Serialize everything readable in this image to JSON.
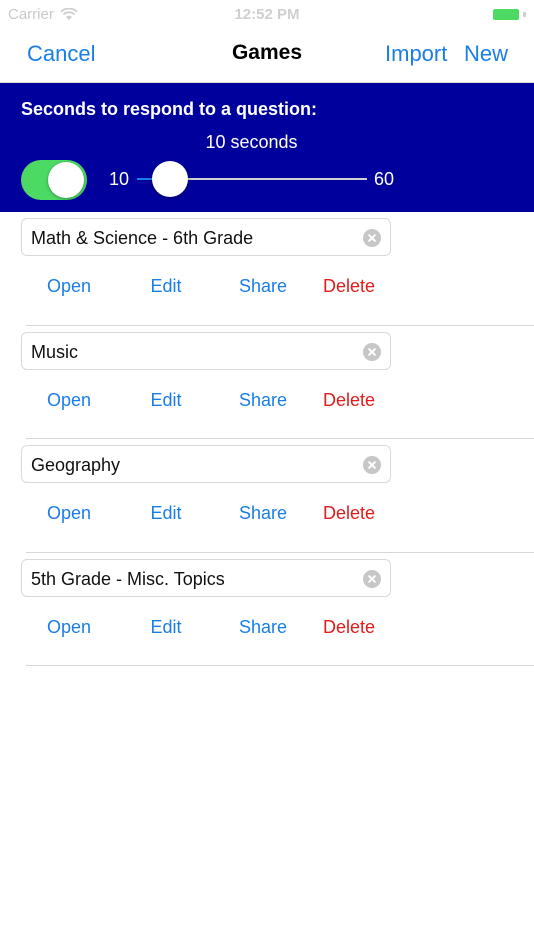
{
  "status_bar": {
    "carrier": "Carrier",
    "time": "12:52 PM"
  },
  "nav": {
    "cancel": "Cancel",
    "title": "Games",
    "import": "Import",
    "new": "New",
    "accent": "#1a7ee6"
  },
  "settings": {
    "label": "Seconds to respond to a question:",
    "value_text": "10 seconds",
    "toggle_on": true,
    "slider": {
      "min": 10,
      "max": 60,
      "value": 10,
      "min_label": "10",
      "max_label": "60"
    },
    "background": "#00009c"
  },
  "games": [
    {
      "name": "Math & Science - 6th Grade"
    },
    {
      "name": "Music"
    },
    {
      "name": "Geography"
    },
    {
      "name": "5th Grade - Misc. Topics"
    }
  ],
  "actions": {
    "open": "Open",
    "edit": "Edit",
    "share": "Share",
    "delete": "Delete",
    "delete_color": "#e21b1b"
  }
}
